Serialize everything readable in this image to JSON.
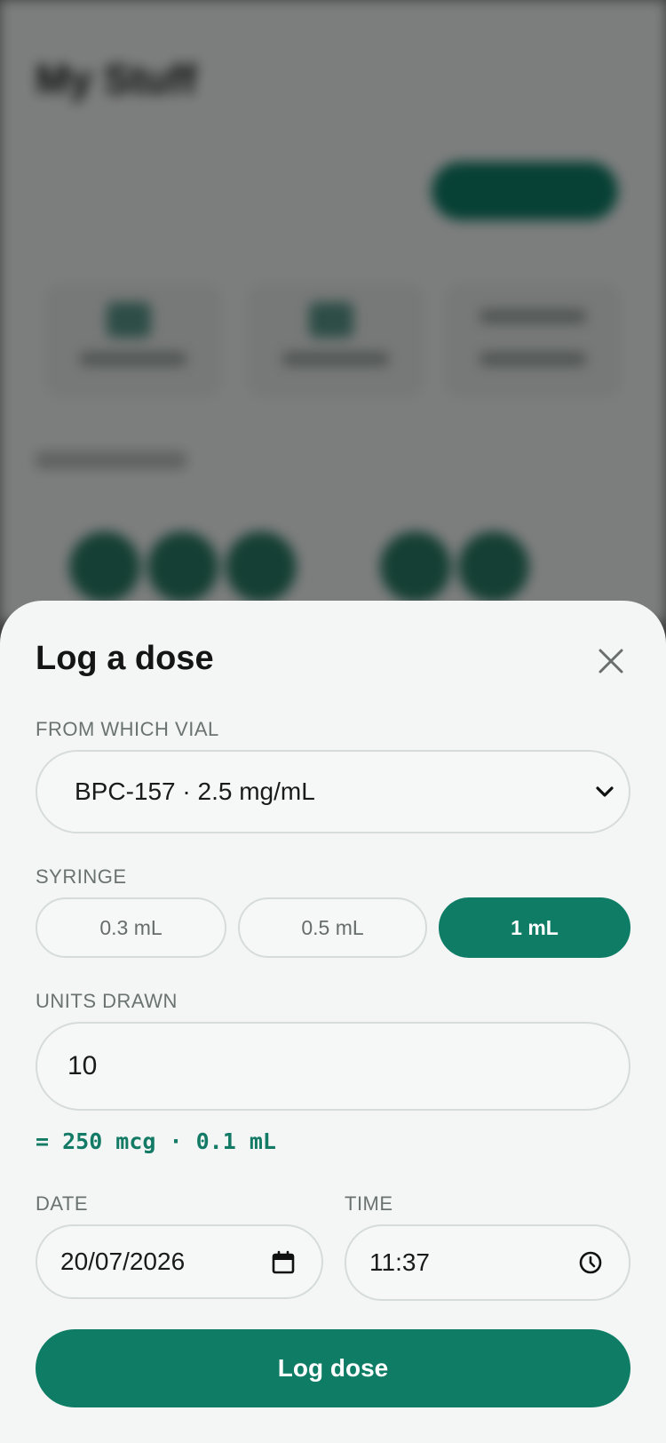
{
  "background": {
    "title": "My Stuff"
  },
  "sheet": {
    "title": "Log a dose",
    "close_icon": "close-icon"
  },
  "vial": {
    "label": "FROM WHICH VIAL",
    "selected": "BPC-157 · 2.5 mg/mL"
  },
  "syringe": {
    "label": "SYRINGE",
    "options": [
      "0.3 mL",
      "0.5 mL",
      "1 mL"
    ],
    "selected": "1 mL"
  },
  "units": {
    "label": "UNITS DRAWN",
    "value": "10",
    "result": "= 250 mcg · 0.1 mL"
  },
  "date": {
    "label": "DATE",
    "value": "20/07/2026",
    "icon": "calendar-icon"
  },
  "time": {
    "label": "TIME",
    "value": "11:37",
    "icon": "clock-icon"
  },
  "submit_label": "Log dose",
  "colors": {
    "accent": "#0f7c66",
    "sheet_bg": "#f3f6f5",
    "border": "#d6dcda"
  }
}
